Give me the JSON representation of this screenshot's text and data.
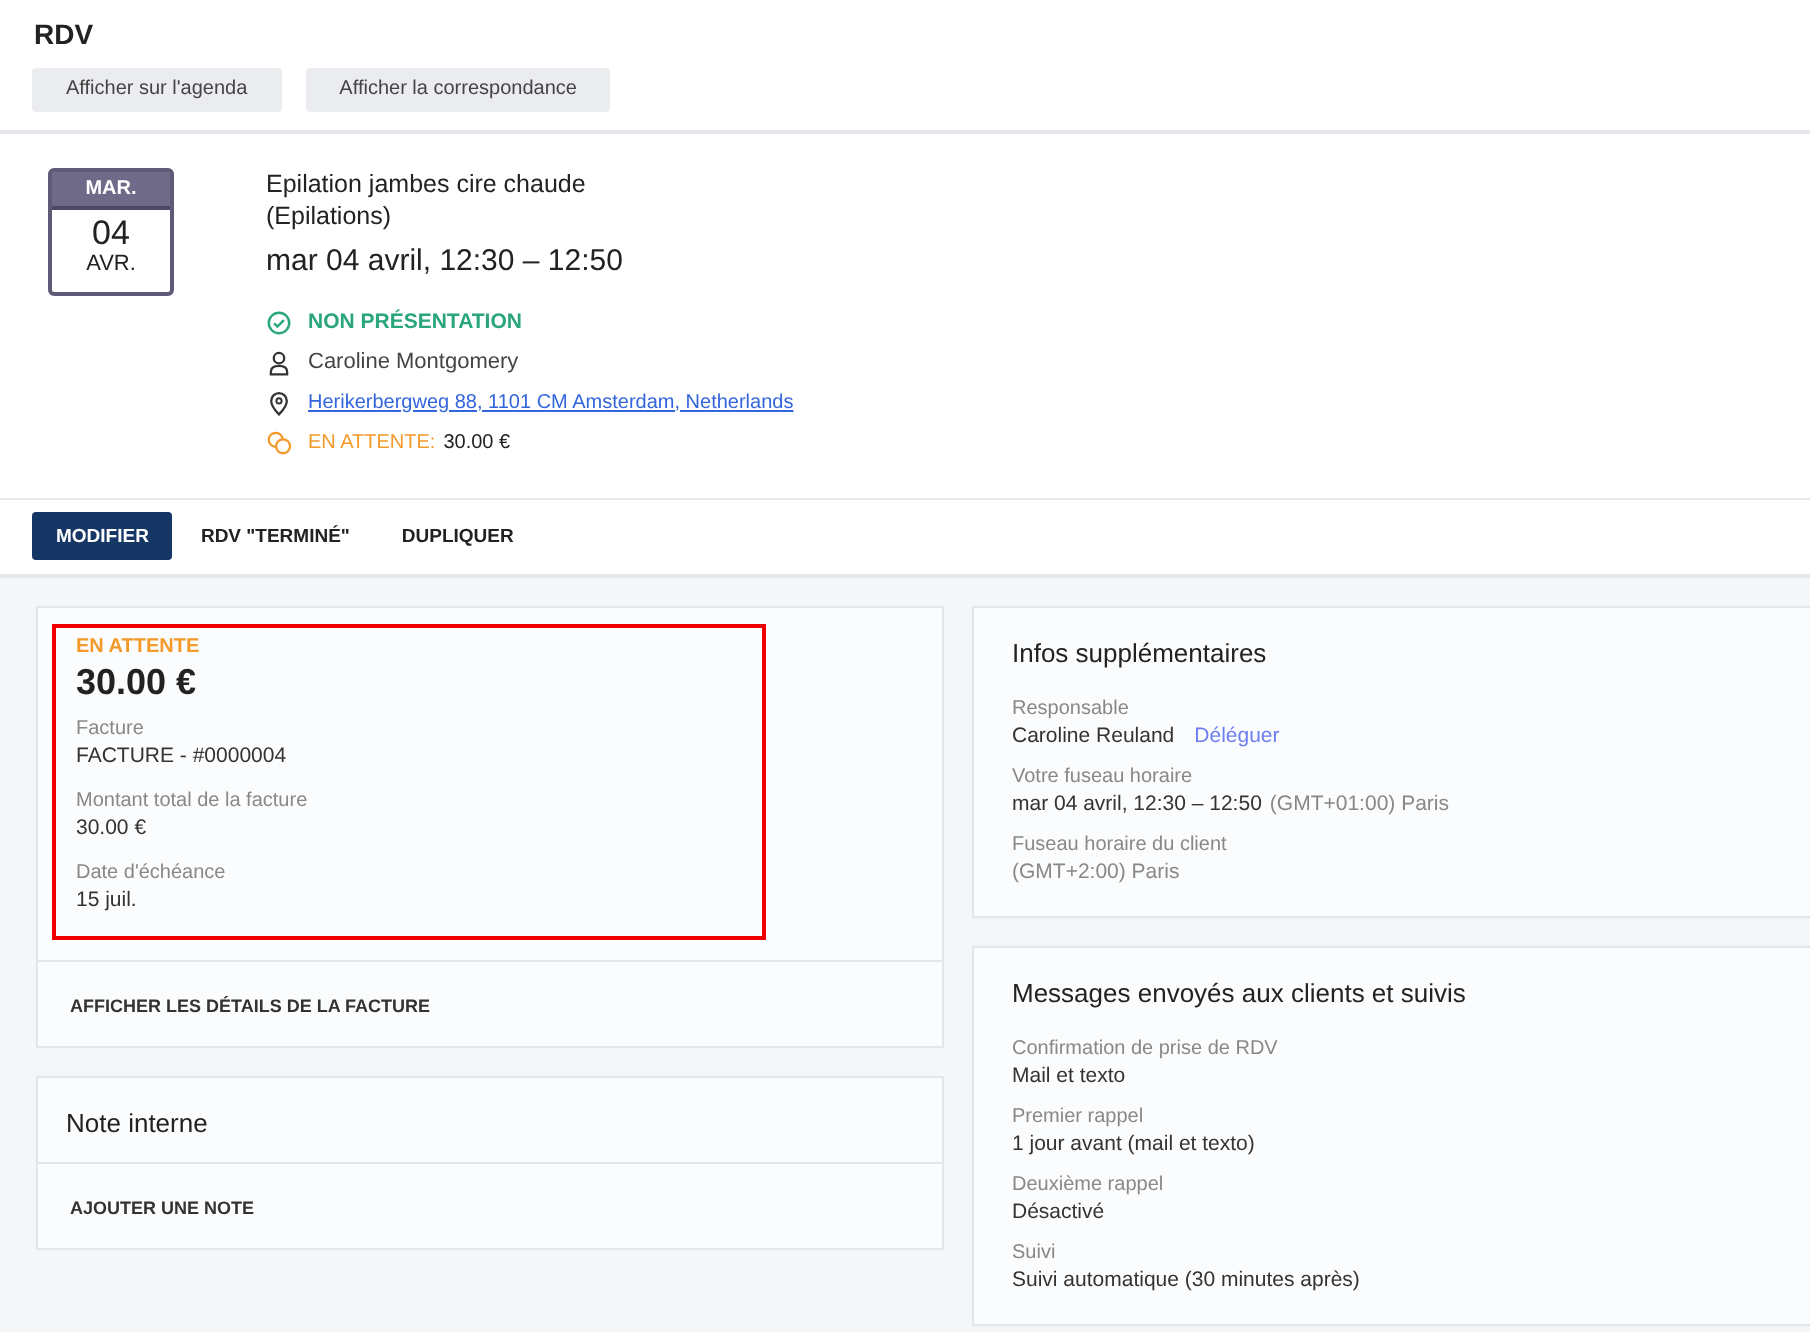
{
  "page_title": "RDV",
  "top_buttons": [
    "Afficher sur l'agenda",
    "Afficher la correspondance"
  ],
  "appointment": {
    "calendar": {
      "weekday": "MAR.",
      "day": "04",
      "month": "AVR."
    },
    "service": "Epilation jambes cire chaude",
    "category": "(Epilations)",
    "datetime": "mar 04 avril, 12:30 – 12:50",
    "details": [
      {
        "kind": "status",
        "text": "NON PRÉSENTATION"
      },
      {
        "kind": "client",
        "text": "Caroline Montgomery"
      },
      {
        "kind": "address",
        "text": "Herikerbergweg 88, 1101 CM Amsterdam, Netherlands"
      },
      {
        "kind": "payment",
        "label": "EN ATTENTE:",
        "text": "30.00 €"
      }
    ]
  },
  "actions": [
    {
      "label": "MODIFIER",
      "selected": true
    },
    {
      "label": "RDV \"TERMINÉ\"",
      "selected": false
    },
    {
      "label": "DUPLIQUER",
      "selected": false
    }
  ],
  "payment_card": {
    "status": "EN ATTENTE",
    "amount": "30.00 €",
    "fields": [
      {
        "label": "Facture",
        "value": "FACTURE - #0000004"
      },
      {
        "label": "Montant total de la facture",
        "value": "30.00 €"
      },
      {
        "label": "Date d'échéance",
        "value": "15 juil."
      }
    ],
    "link": "AFFICHER LES DÉTAILS DE LA FACTURE"
  },
  "note_card": {
    "title": "Note interne",
    "link": "AJOUTER UNE NOTE"
  },
  "info_card": {
    "title": "Infos supplémentaires",
    "fields": [
      {
        "label": "Responsable",
        "value": "Caroline Reuland",
        "action": "Déléguer"
      },
      {
        "label": "Votre fuseau horaire",
        "value": "mar 04 avril, 12:30 – 12:50",
        "suffix": "(GMT+01:00) Paris"
      },
      {
        "label": "Fuseau horaire du client",
        "suffix": "(GMT+2:00) Paris"
      }
    ]
  },
  "messages_card": {
    "title": "Messages envoyés aux clients et suivis",
    "fields": [
      {
        "label": "Confirmation de prise de RDV",
        "value": "Mail et texto"
      },
      {
        "label": "Premier rappel",
        "value": "1 jour avant (mail et texto)"
      },
      {
        "label": "Deuxième rappel",
        "value": "Désactivé"
      },
      {
        "label": "Suivi",
        "value": "Suivi automatique (30 minutes après)"
      }
    ]
  }
}
